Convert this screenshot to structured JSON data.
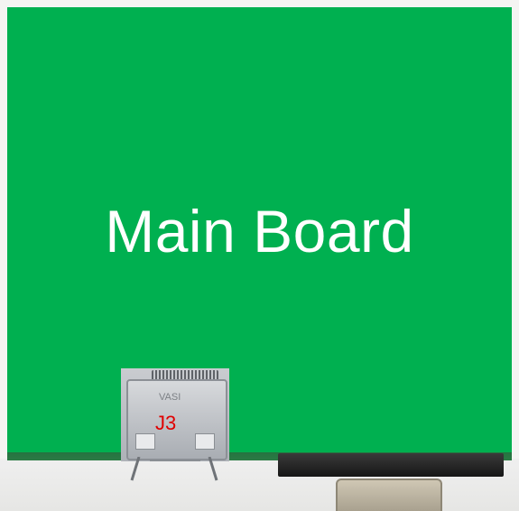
{
  "board": {
    "label": "Main Board",
    "overlay_color": "#00b050",
    "label_color": "#ffffff"
  },
  "connector": {
    "id": "J3",
    "id_color": "#e00000",
    "marking": "VASI"
  },
  "icons": [
    "hdmi-connector-icon",
    "vga-connector-icon"
  ]
}
